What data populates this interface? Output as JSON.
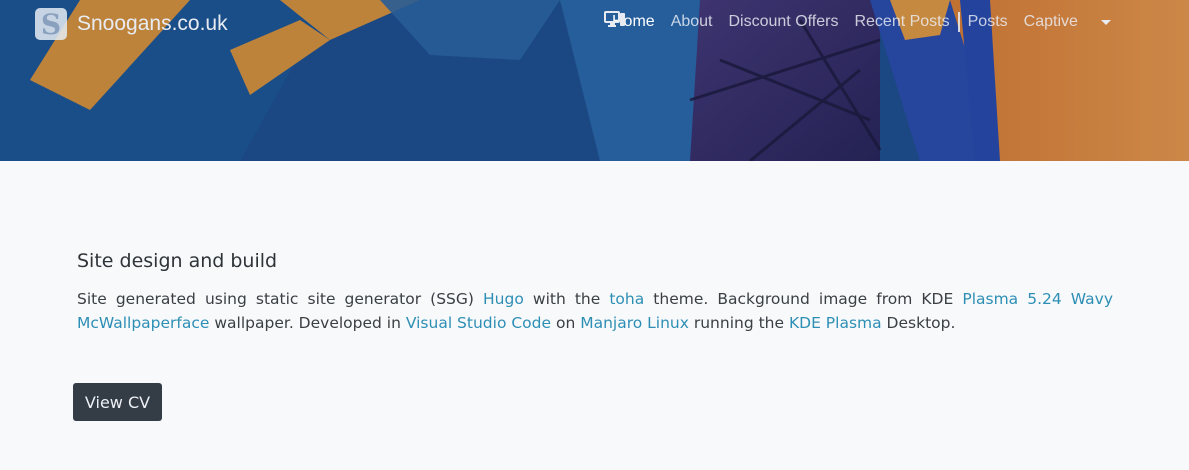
{
  "brand": {
    "logo_letter": "S",
    "name": "Snoogans.co.uk"
  },
  "nav": {
    "items": [
      {
        "label": "Home",
        "active": true
      },
      {
        "label": "About"
      },
      {
        "label": "Discount Offers"
      },
      {
        "label": "Recent Posts"
      },
      {
        "label": "Posts"
      },
      {
        "label": "Captive"
      }
    ],
    "dropdown_icon": "desktop-icon"
  },
  "section": {
    "title": "Site design and build",
    "parts": {
      "t1": "Site generated using static site generator (SSG) ",
      "l1": "Hugo",
      "t2": " with the ",
      "l2": "toha",
      "t3": " theme. Background image from KDE ",
      "l3": "Plasma 5.24 Wavy McWallpaperface",
      "t4": " wallpaper. Developed in ",
      "l4": "Visual Studio Code",
      "t5": " on ",
      "l5": "Manjaro Linux",
      "t6": " running the ",
      "l6": "KDE Plasma",
      "t7": " Desktop."
    }
  },
  "cv_button": {
    "label": "View CV"
  },
  "colors": {
    "link": "#2e8fb5",
    "button": "#343c46",
    "background": "#f8f9fb"
  }
}
